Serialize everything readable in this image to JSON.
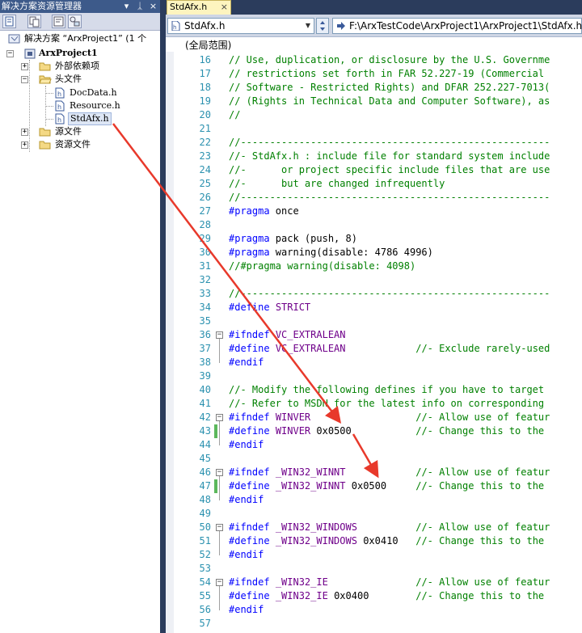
{
  "solution_explorer": {
    "title": "解决方案资源管理器",
    "title_buttons": [
      "▾",
      "ᛣ",
      "×"
    ],
    "toolbar_icons": [
      "properties-icon",
      "show-all-files-icon",
      "view-code-icon",
      "class-diagram-icon"
    ],
    "tree": {
      "solution": "解决方案 “ArxProject1” (1 个",
      "project": "ArxProject1",
      "external_deps": "外部依赖项",
      "header_files": "头文件",
      "headers": [
        "DocData.h",
        "Resource.h",
        "StdAfx.h"
      ],
      "source_files": "源文件",
      "resource_files": "资源文件"
    }
  },
  "editor": {
    "tab_label": "StdAfx.h",
    "tab_close": "×",
    "file_combo": "StdAfx.h",
    "path": "F:\\ArxTestCode\\ArxProject1\\ArxProject1\\StdAfx.h",
    "scope": "(全局范围)",
    "lines": [
      {
        "n": "16",
        "tokens": [
          [
            "c",
            "// Use, duplication, or disclosure by the U.S. Governme"
          ]
        ]
      },
      {
        "n": "17",
        "tokens": [
          [
            "c",
            "// restrictions set forth in FAR 52.227-19 (Commercial"
          ]
        ]
      },
      {
        "n": "18",
        "tokens": [
          [
            "c",
            "// Software - Restricted Rights) and DFAR 252.227-7013("
          ]
        ]
      },
      {
        "n": "19",
        "tokens": [
          [
            "c",
            "// (Rights in Technical Data and Computer Software), as"
          ]
        ]
      },
      {
        "n": "20",
        "tokens": [
          [
            "c",
            "//"
          ]
        ]
      },
      {
        "n": "21",
        "tokens": []
      },
      {
        "n": "22",
        "tokens": [
          [
            "c",
            "//-----------------------------------------------------"
          ]
        ]
      },
      {
        "n": "23",
        "tokens": [
          [
            "c",
            "//- StdAfx.h : include file for standard system include"
          ]
        ]
      },
      {
        "n": "24",
        "tokens": [
          [
            "c",
            "//-      or project specific include files that are use"
          ]
        ]
      },
      {
        "n": "25",
        "tokens": [
          [
            "c",
            "//-      but are changed infrequently"
          ]
        ]
      },
      {
        "n": "26",
        "tokens": [
          [
            "c",
            "//-----------------------------------------------------"
          ]
        ]
      },
      {
        "n": "27",
        "tokens": [
          [
            "k",
            "#pragma"
          ],
          [
            "t",
            " once"
          ]
        ]
      },
      {
        "n": "28",
        "tokens": []
      },
      {
        "n": "29",
        "tokens": [
          [
            "k",
            "#pragma"
          ],
          [
            "t",
            " pack (push, 8)"
          ]
        ]
      },
      {
        "n": "30",
        "tokens": [
          [
            "k",
            "#pragma"
          ],
          [
            "t",
            " warning(disable: 4786 4996)"
          ]
        ]
      },
      {
        "n": "31",
        "tokens": [
          [
            "c",
            "//#pragma warning(disable: 4098)"
          ]
        ]
      },
      {
        "n": "32",
        "tokens": []
      },
      {
        "n": "33",
        "tokens": [
          [
            "c",
            "//-----------------------------------------------------"
          ]
        ]
      },
      {
        "n": "34",
        "tokens": [
          [
            "k",
            "#define"
          ],
          [
            "t",
            " "
          ],
          [
            "m",
            "STRICT"
          ]
        ]
      },
      {
        "n": "35",
        "tokens": []
      },
      {
        "n": "36",
        "tokens": [
          [
            "k",
            "#ifndef"
          ],
          [
            "t",
            " "
          ],
          [
            "m",
            "VC_EXTRALEAN"
          ]
        ]
      },
      {
        "n": "37",
        "tokens": [
          [
            "k",
            "#define"
          ],
          [
            "t",
            " "
          ],
          [
            "m",
            "VC_EXTRALEAN"
          ],
          [
            "t",
            "            "
          ],
          [
            "c",
            "//- Exclude rarely-used"
          ]
        ]
      },
      {
        "n": "38",
        "tokens": [
          [
            "k",
            "#endif"
          ]
        ]
      },
      {
        "n": "39",
        "tokens": []
      },
      {
        "n": "40",
        "tokens": [
          [
            "c",
            "//- Modify the following defines if you have to target"
          ]
        ]
      },
      {
        "n": "41",
        "tokens": [
          [
            "c",
            "//- Refer to MSDN for the latest info on corresponding"
          ]
        ]
      },
      {
        "n": "42",
        "tokens": [
          [
            "k",
            "#ifndef"
          ],
          [
            "t",
            " "
          ],
          [
            "m",
            "WINVER"
          ],
          [
            "t",
            "                  "
          ],
          [
            "c",
            "//- Allow use of featur"
          ]
        ]
      },
      {
        "n": "43",
        "tokens": [
          [
            "k",
            "#define"
          ],
          [
            "t",
            " "
          ],
          [
            "m",
            "WINVER"
          ],
          [
            "t",
            " 0x0500           "
          ],
          [
            "c",
            "//- Change this to the"
          ]
        ]
      },
      {
        "n": "44",
        "tokens": [
          [
            "k",
            "#endif"
          ]
        ]
      },
      {
        "n": "45",
        "tokens": []
      },
      {
        "n": "46",
        "tokens": [
          [
            "k",
            "#ifndef"
          ],
          [
            "t",
            " "
          ],
          [
            "m",
            "_WIN32_WINNT"
          ],
          [
            "t",
            "            "
          ],
          [
            "c",
            "//- Allow use of featur"
          ]
        ]
      },
      {
        "n": "47",
        "tokens": [
          [
            "k",
            "#define"
          ],
          [
            "t",
            " "
          ],
          [
            "m",
            "_WIN32_WINNT"
          ],
          [
            "t",
            " 0x0500     "
          ],
          [
            "c",
            "//- Change this to the"
          ]
        ]
      },
      {
        "n": "48",
        "tokens": [
          [
            "k",
            "#endif"
          ]
        ]
      },
      {
        "n": "49",
        "tokens": []
      },
      {
        "n": "50",
        "tokens": [
          [
            "k",
            "#ifndef"
          ],
          [
            "t",
            " "
          ],
          [
            "m",
            "_WIN32_WINDOWS"
          ],
          [
            "t",
            "          "
          ],
          [
            "c",
            "//- Allow use of featur"
          ]
        ]
      },
      {
        "n": "51",
        "tokens": [
          [
            "k",
            "#define"
          ],
          [
            "t",
            " "
          ],
          [
            "m",
            "_WIN32_WINDOWS"
          ],
          [
            "t",
            " 0x0410   "
          ],
          [
            "c",
            "//- Change this to the"
          ]
        ]
      },
      {
        "n": "52",
        "tokens": [
          [
            "k",
            "#endif"
          ]
        ]
      },
      {
        "n": "53",
        "tokens": []
      },
      {
        "n": "54",
        "tokens": [
          [
            "k",
            "#ifndef"
          ],
          [
            "t",
            " "
          ],
          [
            "m",
            "_WIN32_IE"
          ],
          [
            "t",
            "               "
          ],
          [
            "c",
            "//- Allow use of featur"
          ]
        ]
      },
      {
        "n": "55",
        "tokens": [
          [
            "k",
            "#define"
          ],
          [
            "t",
            " "
          ],
          [
            "m",
            "_WIN32_IE"
          ],
          [
            "t",
            " 0x0400        "
          ],
          [
            "c",
            "//- Change this to the"
          ]
        ]
      },
      {
        "n": "56",
        "tokens": [
          [
            "k",
            "#endif"
          ]
        ]
      },
      {
        "n": "57",
        "tokens": []
      }
    ],
    "changed_lines": [
      "43",
      "47"
    ],
    "fold_lines": [
      "36",
      "42",
      "46",
      "50",
      "54"
    ]
  },
  "annotation": {
    "arrow_color": "#e8392b",
    "arrows": [
      "arrow-from-stdafx-to-winver",
      "arrow-to-win32-winnt"
    ]
  },
  "colors": {
    "comment": "#008000",
    "keyword": "#0000ff",
    "macro": "#6f008a",
    "line_number": "#2b91af",
    "title_bar": "#3d5a8a"
  }
}
